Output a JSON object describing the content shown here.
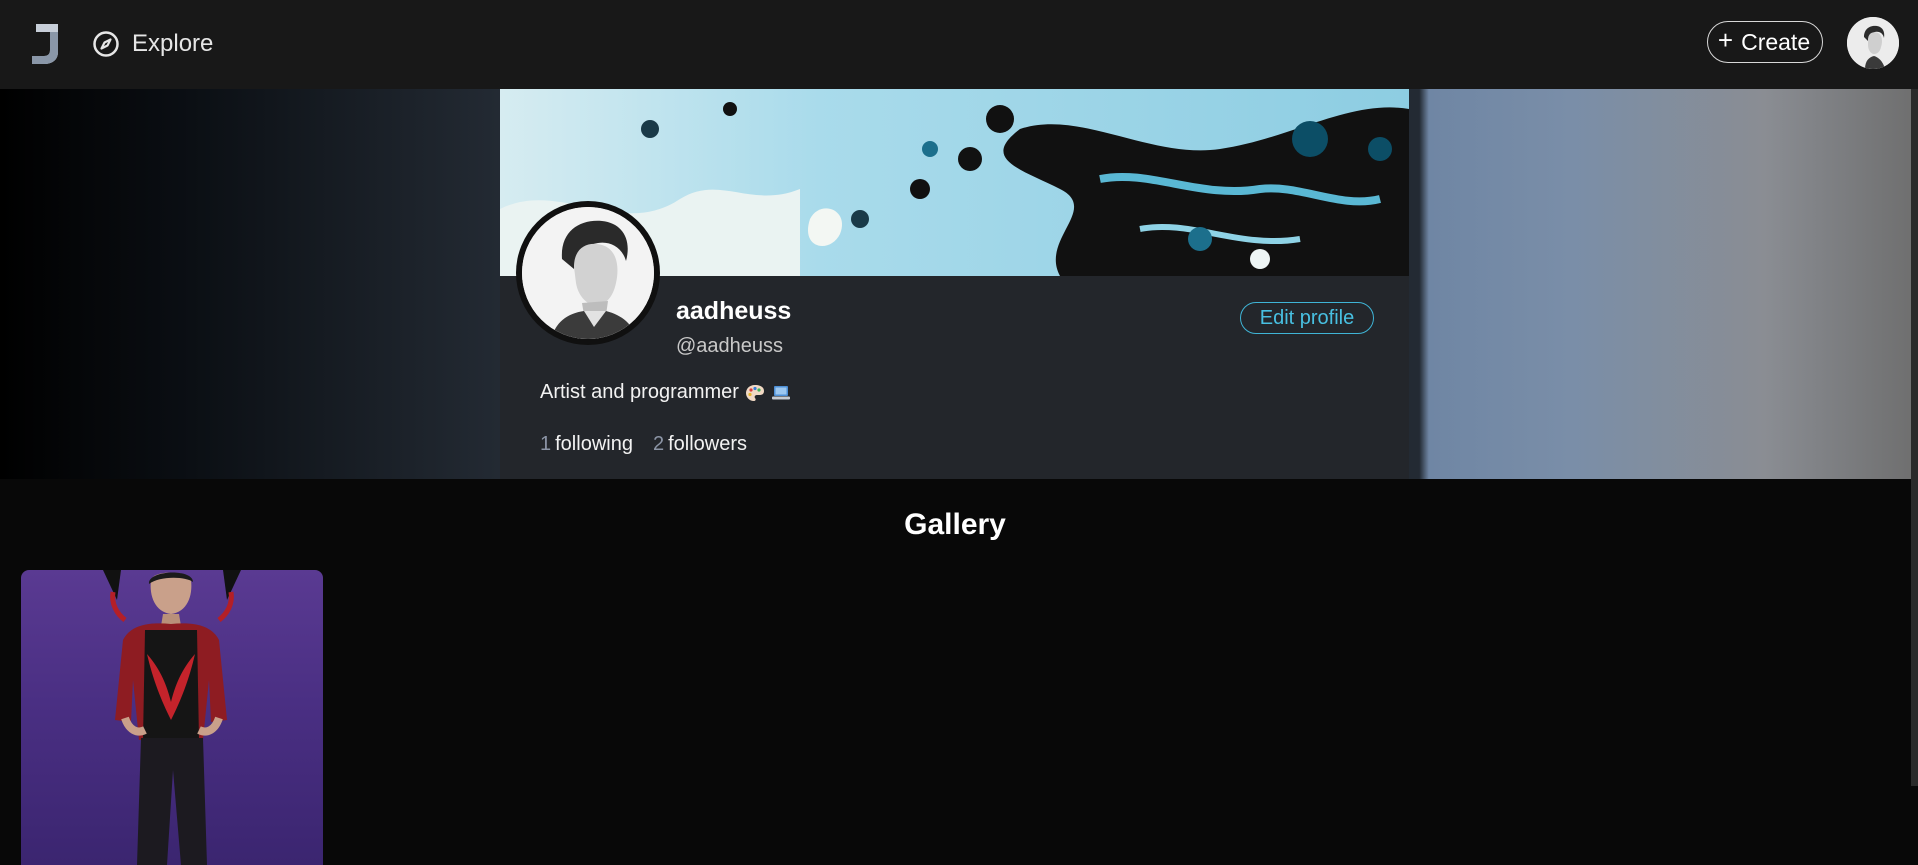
{
  "nav": {
    "logo_letter": "J",
    "explore_label": "Explore",
    "create_label": "Create",
    "create_icon": "plus-icon",
    "explore_icon": "compass-icon"
  },
  "profile": {
    "display_name": "aadheuss",
    "handle": "@aadheuss",
    "bio": "Artist and programmer",
    "bio_emojis": [
      "palette-icon",
      "laptop-icon"
    ],
    "edit_label": "Edit profile",
    "following_count": "1",
    "following_label": "following",
    "followers_count": "2",
    "followers_label": "followers"
  },
  "gallery": {
    "title": "Gallery",
    "items": [
      {
        "kind": "artwork-thumbnail"
      }
    ]
  },
  "colors": {
    "accent": "#48c0e2",
    "nav_bg": "#181818",
    "card_bg": "#23262b",
    "page_bg": "#080808"
  }
}
